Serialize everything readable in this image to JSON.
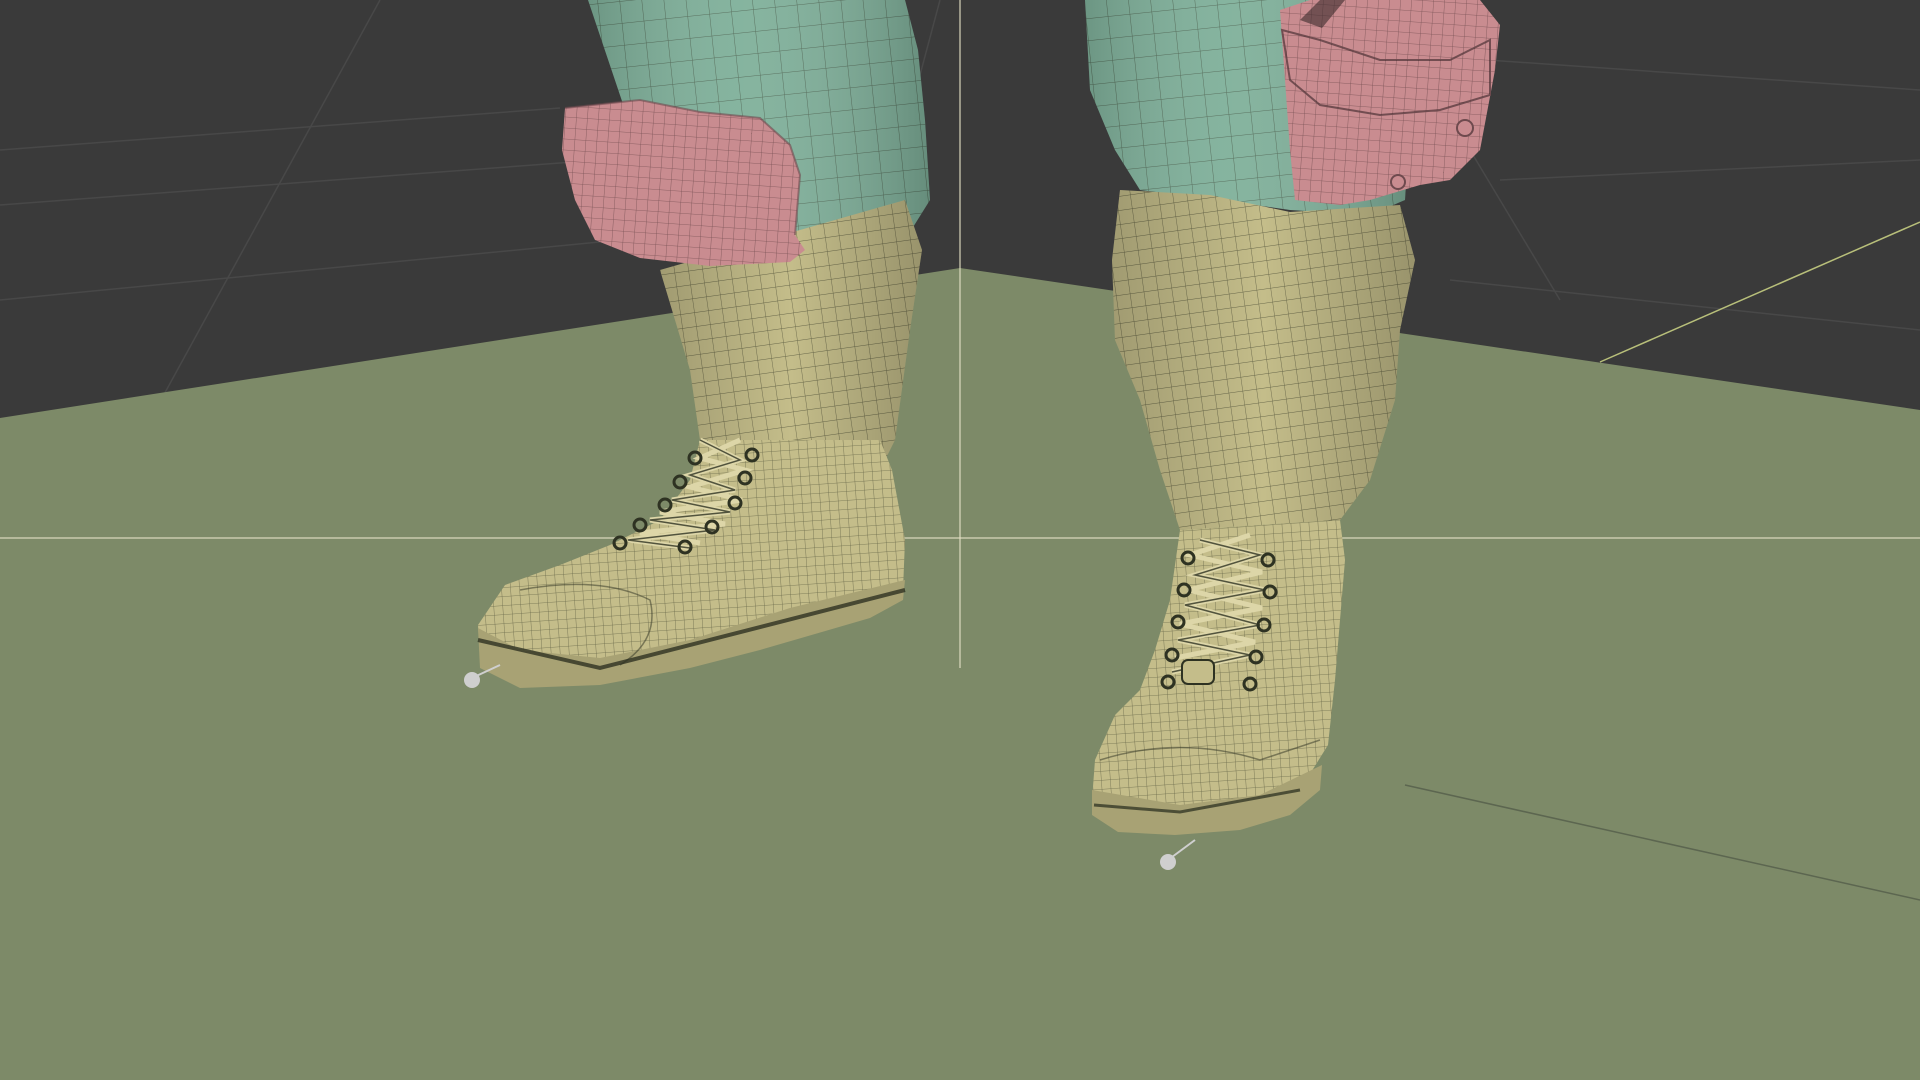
{
  "viewport": {
    "mode": "3d-viewport",
    "overlay": "wireframe",
    "background_color": "#3a3a3a",
    "grid_color": "#484848",
    "ground_color": "#7d8a68",
    "cursor_color": "#e4e0c4",
    "axis_line_color": "#b8bf7a"
  },
  "model": {
    "pants_color": "#7fb09a",
    "cuff_color": "#c98c90",
    "boot_color": "#c4bd8a",
    "lace_color": "#ddd6a8",
    "wire_color": "#2e3222"
  },
  "origin_markers": {
    "color": "#cfcfcf"
  }
}
